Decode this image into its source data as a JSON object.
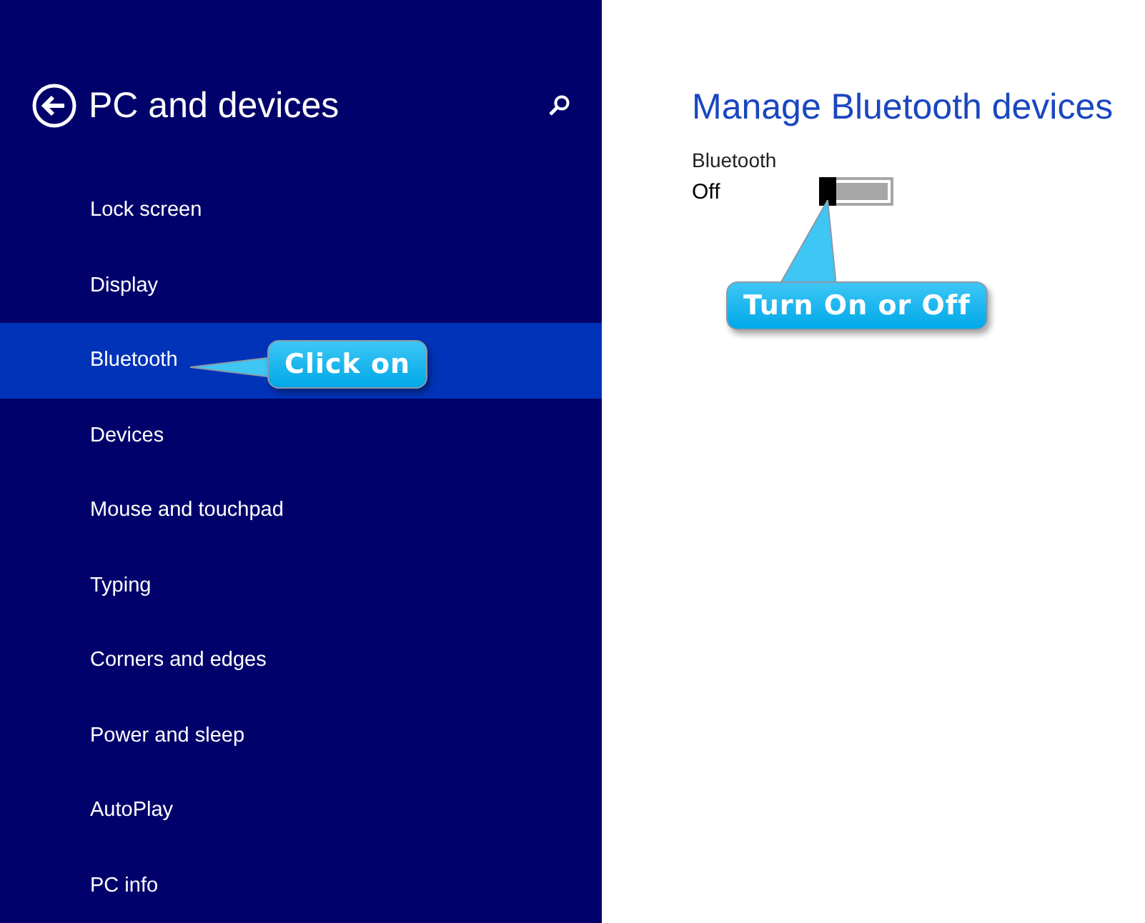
{
  "sidebar": {
    "title": "PC and devices",
    "items": [
      {
        "label": "Lock screen",
        "selected": false
      },
      {
        "label": "Display",
        "selected": false
      },
      {
        "label": "Bluetooth",
        "selected": true
      },
      {
        "label": "Devices",
        "selected": false
      },
      {
        "label": "Mouse and touchpad",
        "selected": false
      },
      {
        "label": "Typing",
        "selected": false
      },
      {
        "label": "Corners and edges",
        "selected": false
      },
      {
        "label": "Power and sleep",
        "selected": false
      },
      {
        "label": "AutoPlay",
        "selected": false
      },
      {
        "label": "PC info",
        "selected": false
      }
    ]
  },
  "main": {
    "title": "Manage Bluetooth devices",
    "setting": {
      "label": "Bluetooth",
      "state": "Off",
      "on": false
    }
  },
  "callouts": [
    {
      "text": "Click on"
    },
    {
      "text": "Turn On or Off"
    }
  ]
}
